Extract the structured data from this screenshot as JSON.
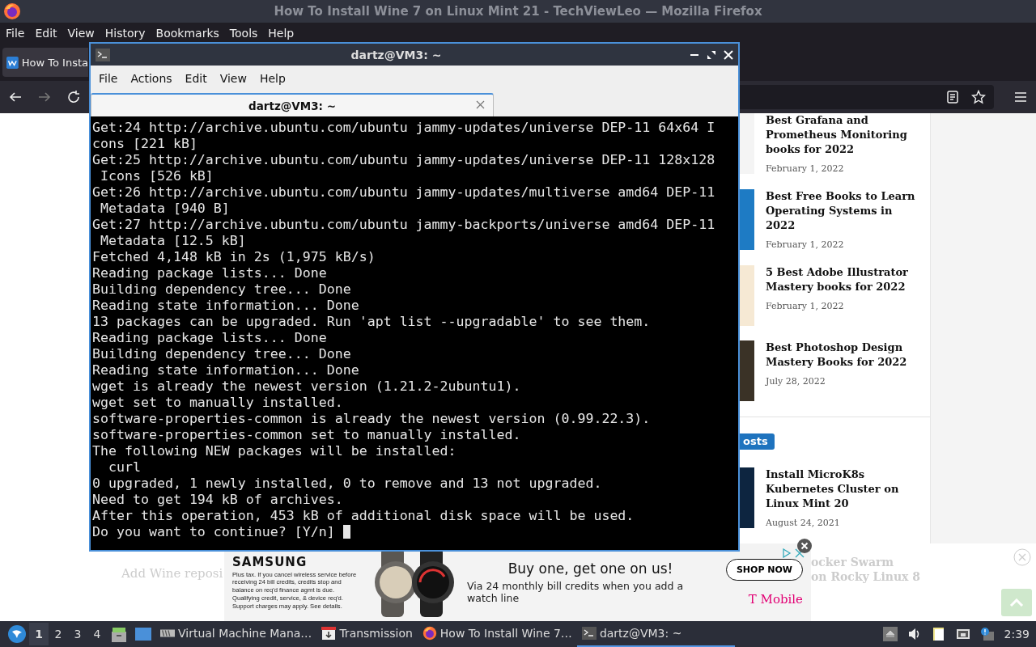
{
  "browser": {
    "title": "How To Install Wine 7 on Linux Mint 21 - TechViewLeo — Mozilla Firefox",
    "menu": [
      "File",
      "Edit",
      "View",
      "History",
      "Bookmarks",
      "Tools",
      "Help"
    ],
    "tabs": [
      {
        "label": "How To Insta",
        "selected": true
      }
    ]
  },
  "sidebar": {
    "posts": [
      {
        "title": "Best Grafana and Prometheus Monitoring books for 2022",
        "date": "February 1, 2022",
        "color": "#f4f4f4"
      },
      {
        "title": "Best Free Books to Learn Operating Systems in 2022",
        "date": "February 1, 2022",
        "color": "#1e7bc4"
      },
      {
        "title": "5 Best Adobe Illustrator Mastery books for 2022",
        "date": "February 1, 2022",
        "color": "#f6e9d4"
      },
      {
        "title": "Best Photoshop Design Mastery Books for 2022",
        "date": "July 28, 2022",
        "color": "#3a3226"
      }
    ],
    "badge": "osts",
    "recent": [
      {
        "title": "Install MicroK8s Kubernetes Cluster on Linux Mint 20",
        "date": "August 24, 2021",
        "color": "#0d2540"
      }
    ]
  },
  "faded": {
    "left": "Add Wine reposi",
    "right": [
      "ocker Swarm",
      "on Rocky Linux 8"
    ]
  },
  "ad": {
    "brand": "SAMSUNG",
    "disclaimer": "Plus tax. If you cancel wireless service before receiving 24 bill credits, credits stop and balance on req'd finance agmt is due. Qualifying credit, service, & device req'd. Support charges may apply. See details.",
    "headline": "Buy one, get one on us!",
    "subline": "Via 24 monthly bill credits when you add a watch line",
    "cta": "SHOP NOW",
    "carrier": "T Mobile"
  },
  "terminal": {
    "title": "dartz@VM3: ~",
    "menu": [
      "File",
      "Actions",
      "Edit",
      "View",
      "Help"
    ],
    "tabs": [
      {
        "label": "dartz@VM3: ~",
        "selected": true
      }
    ],
    "lines": [
      "Get:24 http://archive.ubuntu.com/ubuntu jammy-updates/universe DEP-11 64x64 I",
      "cons [221 kB]",
      "Get:25 http://archive.ubuntu.com/ubuntu jammy-updates/universe DEP-11 128x128",
      " Icons [526 kB]",
      "Get:26 http://archive.ubuntu.com/ubuntu jammy-updates/multiverse amd64 DEP-11",
      " Metadata [940 B]",
      "Get:27 http://archive.ubuntu.com/ubuntu jammy-backports/universe amd64 DEP-11",
      " Metadata [12.5 kB]",
      "Fetched 4,148 kB in 2s (1,975 kB/s)",
      "Reading package lists... Done",
      "Building dependency tree... Done",
      "Reading state information... Done",
      "13 packages can be upgraded. Run 'apt list --upgradable' to see them.",
      "Reading package lists... Done",
      "Building dependency tree... Done",
      "Reading state information... Done",
      "wget is already the newest version (1.21.2-2ubuntu1).",
      "wget set to manually installed.",
      "software-properties-common is already the newest version (0.99.22.3).",
      "software-properties-common set to manually installed.",
      "The following NEW packages will be installed:",
      "  curl",
      "0 upgraded, 1 newly installed, 0 to remove and 13 not upgraded.",
      "Need to get 194 kB of archives.",
      "After this operation, 453 kB of additional disk space will be used.",
      "Do you want to continue? [Y/n] "
    ]
  },
  "taskbar": {
    "workspaces": [
      {
        "label": "1",
        "selected": true
      },
      {
        "label": "2",
        "selected": false
      },
      {
        "label": "3",
        "selected": false
      },
      {
        "label": "4",
        "selected": false
      }
    ],
    "tasks": [
      {
        "kind": "vm",
        "label": "Virtual Machine Mana…",
        "selected": false
      },
      {
        "kind": "transmission",
        "label": "Transmission",
        "selected": false
      },
      {
        "kind": "firefox",
        "label": "How To Install Wine 7…",
        "selected": false
      },
      {
        "kind": "terminal",
        "label": "dartz@VM3: ~",
        "selected": true
      }
    ],
    "clock": "2:39"
  }
}
